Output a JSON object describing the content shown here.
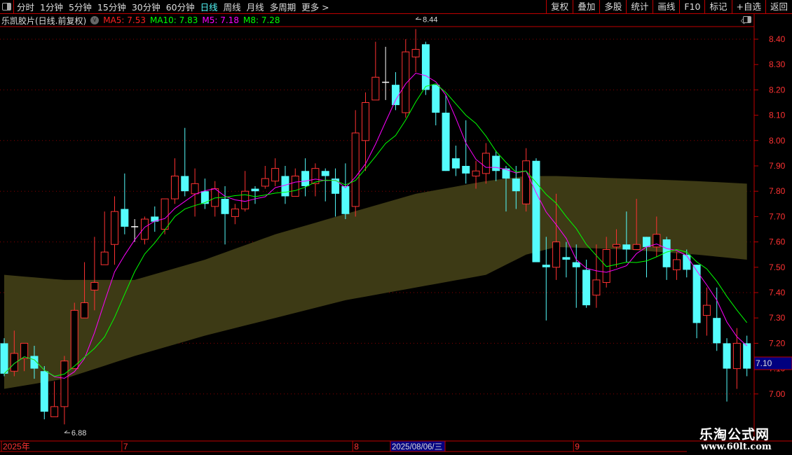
{
  "toolbar": {
    "tabs": [
      "分时",
      "1分钟",
      "5分钟",
      "15分钟",
      "30分钟",
      "60分钟",
      "日线",
      "周线",
      "月线",
      "多周期",
      "更多 >"
    ],
    "active_tab": "日线",
    "right_buttons": [
      "复权",
      "叠加",
      "多股",
      "统计",
      "画线",
      "F10",
      "标记",
      "+自选",
      "返回"
    ]
  },
  "info": {
    "title": "乐凯胶片(日线.前复权)",
    "ma5": "MA5: 7.53",
    "ma10": "MA10: 7.83",
    "m5": "M5: 7.18",
    "m8": "M8: 7.28"
  },
  "colors": {
    "up": "#ff3232",
    "down": "#54fcfc",
    "doji": "#ffffff",
    "m5": "#ff00ff",
    "m8": "#00ff00",
    "band": "#3d3a15",
    "axis": "#c00000",
    "grid": "#8b0000",
    "ma5_label": "#ff2020",
    "ma10_label": "#00ff00",
    "m5_label": "#ff00ff",
    "m8_label": "#00ff00"
  },
  "chart_data": {
    "type": "candlestick",
    "ylim": [
      6.88,
      8.44
    ],
    "y_ticks": [
      "8.40",
      "8.30",
      "8.20",
      "8.10",
      "8.00",
      "7.90",
      "7.80",
      "7.70",
      "7.60",
      "7.50",
      "7.40",
      "7.30",
      "7.20",
      "7.10",
      "7.00"
    ],
    "x_labels": [
      {
        "day": 1,
        "text": "2025年"
      },
      {
        "day": 13,
        "text": "7"
      },
      {
        "day": 36,
        "text": "8"
      },
      {
        "day": 58,
        "text": "9"
      }
    ],
    "cursor_date": "2025/08/06/三",
    "last_price": "7.10",
    "high_marker": {
      "day": 42,
      "text": "8.44"
    },
    "low_marker": {
      "day": 7,
      "text": "6.88"
    },
    "ohlc": [
      [
        7.2,
        7.22,
        7.07,
        7.08
      ],
      [
        7.09,
        7.25,
        7.07,
        7.16
      ],
      [
        7.14,
        7.2,
        7.09,
        7.2
      ],
      [
        7.15,
        7.19,
        7.06,
        7.1
      ],
      [
        7.09,
        7.11,
        6.9,
        6.93
      ],
      [
        6.91,
        7.05,
        6.91,
        6.95
      ],
      [
        6.95,
        7.15,
        6.88,
        7.13
      ],
      [
        7.1,
        7.36,
        7.1,
        7.33
      ],
      [
        7.3,
        7.52,
        7.3,
        7.36
      ],
      [
        7.41,
        7.62,
        7.33,
        7.44
      ],
      [
        7.51,
        7.72,
        7.51,
        7.56
      ],
      [
        7.59,
        7.78,
        7.51,
        7.72
      ],
      [
        7.73,
        7.87,
        7.63,
        7.66
      ],
      [
        7.66,
        7.69,
        7.6,
        7.66
      ],
      [
        7.61,
        7.7,
        7.59,
        7.69
      ],
      [
        7.7,
        7.74,
        7.64,
        7.68
      ],
      [
        7.65,
        7.77,
        7.63,
        7.77
      ],
      [
        7.77,
        7.93,
        7.75,
        7.86
      ],
      [
        7.86,
        8.05,
        7.78,
        7.8
      ],
      [
        7.79,
        7.89,
        7.7,
        7.83
      ],
      [
        7.8,
        7.85,
        7.73,
        7.75
      ],
      [
        7.74,
        7.84,
        7.7,
        7.81
      ],
      [
        7.77,
        7.82,
        7.59,
        7.71
      ],
      [
        7.7,
        7.75,
        7.67,
        7.73
      ],
      [
        7.73,
        7.88,
        7.72,
        7.8
      ],
      [
        7.81,
        7.82,
        7.75,
        7.8
      ],
      [
        7.82,
        7.9,
        7.81,
        7.85
      ],
      [
        7.84,
        7.93,
        7.82,
        7.89
      ],
      [
        7.86,
        7.9,
        7.75,
        7.78
      ],
      [
        7.78,
        7.89,
        7.78,
        7.86
      ],
      [
        7.88,
        7.93,
        7.78,
        7.82
      ],
      [
        7.83,
        7.91,
        7.78,
        7.89
      ],
      [
        7.88,
        7.89,
        7.76,
        7.86
      ],
      [
        7.85,
        7.89,
        7.7,
        7.79
      ],
      [
        7.82,
        7.91,
        7.69,
        7.71
      ],
      [
        7.74,
        8.12,
        7.7,
        8.03
      ],
      [
        8.0,
        8.19,
        7.88,
        8.15
      ],
      [
        8.16,
        8.39,
        8.16,
        8.25
      ],
      [
        8.23,
        8.37,
        8.16,
        8.23
      ],
      [
        8.22,
        8.27,
        8.12,
        8.14
      ],
      [
        8.11,
        8.4,
        8.09,
        8.35
      ],
      [
        8.33,
        8.44,
        8.27,
        8.36
      ],
      [
        8.38,
        8.39,
        8.18,
        8.2
      ],
      [
        8.22,
        8.22,
        8.06,
        8.11
      ],
      [
        8.11,
        8.18,
        7.88,
        7.88
      ],
      [
        7.93,
        7.98,
        7.86,
        7.89
      ],
      [
        7.9,
        8.08,
        7.83,
        7.87
      ],
      [
        7.86,
        7.92,
        7.81,
        7.88
      ],
      [
        7.87,
        7.99,
        7.83,
        7.95
      ],
      [
        7.94,
        7.96,
        7.84,
        7.88
      ],
      [
        7.89,
        7.9,
        7.72,
        7.85
      ],
      [
        7.85,
        7.9,
        7.73,
        7.8
      ],
      [
        7.75,
        7.97,
        7.72,
        7.92
      ],
      [
        7.92,
        7.93,
        7.52,
        7.52
      ],
      [
        7.51,
        7.62,
        7.29,
        7.5
      ],
      [
        7.5,
        7.79,
        7.45,
        7.6
      ],
      [
        7.54,
        7.6,
        7.46,
        7.53
      ],
      [
        7.52,
        7.59,
        7.34,
        7.5
      ],
      [
        7.49,
        7.53,
        7.34,
        7.35
      ],
      [
        7.39,
        7.59,
        7.34,
        7.45
      ],
      [
        7.44,
        7.62,
        7.42,
        7.57
      ],
      [
        7.58,
        7.65,
        7.5,
        7.59
      ],
      [
        7.59,
        7.72,
        7.52,
        7.57
      ],
      [
        7.57,
        7.77,
        7.57,
        7.59
      ],
      [
        7.62,
        7.62,
        7.46,
        7.58
      ],
      [
        7.58,
        7.7,
        7.54,
        7.63
      ],
      [
        7.61,
        7.62,
        7.45,
        7.5
      ],
      [
        7.49,
        7.56,
        7.45,
        7.53
      ],
      [
        7.55,
        7.57,
        7.46,
        7.49
      ],
      [
        7.51,
        7.51,
        7.22,
        7.28
      ],
      [
        7.31,
        7.42,
        7.23,
        7.35
      ],
      [
        7.3,
        7.42,
        7.17,
        7.2
      ],
      [
        7.2,
        7.22,
        6.97,
        7.1
      ],
      [
        7.1,
        7.26,
        7.02,
        7.2
      ],
      [
        7.2,
        7.23,
        7.07,
        7.1
      ]
    ],
    "band_ma10_upper": [
      [
        1,
        7.47
      ],
      [
        7,
        7.45
      ],
      [
        14,
        7.45
      ],
      [
        21,
        7.53
      ],
      [
        28,
        7.63
      ],
      [
        35,
        7.71
      ],
      [
        42,
        7.79
      ],
      [
        49,
        7.84
      ],
      [
        53,
        7.86
      ],
      [
        56,
        7.86
      ],
      [
        63,
        7.85
      ],
      [
        70,
        7.84
      ],
      [
        75,
        7.83
      ]
    ],
    "band_ma5_lower": [
      [
        1,
        7.02
      ],
      [
        7,
        7.06
      ],
      [
        14,
        7.15
      ],
      [
        21,
        7.23
      ],
      [
        28,
        7.3
      ],
      [
        35,
        7.37
      ],
      [
        42,
        7.42
      ],
      [
        49,
        7.47
      ],
      [
        53,
        7.55
      ],
      [
        56,
        7.58
      ],
      [
        63,
        7.57
      ],
      [
        70,
        7.55
      ],
      [
        75,
        7.53
      ]
    ],
    "lines": [
      {
        "name": "M5",
        "period": 5
      },
      {
        "name": "M8",
        "period": 8
      }
    ]
  },
  "watermark": {
    "name": "乐淘公式网",
    "url": "www.60lt.com"
  }
}
